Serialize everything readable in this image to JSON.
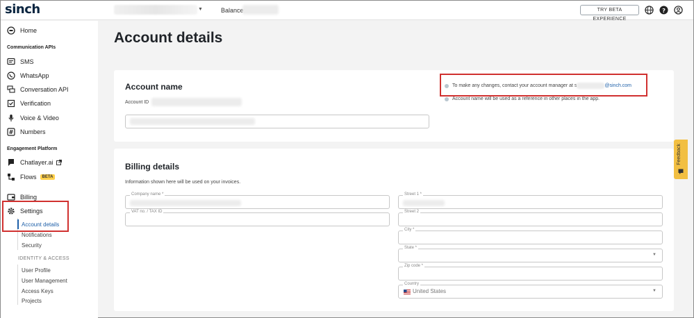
{
  "header": {
    "logo": "sinch",
    "balance_label": "Balance:",
    "beta_button": "TRY BETA EXPERIENCE",
    "icons": [
      "globe-icon",
      "help-icon",
      "user-icon"
    ]
  },
  "sidebar": {
    "home": "Home",
    "section_comm": "Communication APIs",
    "comm_items": [
      "SMS",
      "WhatsApp",
      "Conversation API",
      "Verification",
      "Voice & Video",
      "Numbers"
    ],
    "section_engagement": "Engagement Platform",
    "chatlayer": "Chatlayer.ai",
    "flows": "Flows",
    "beta_tag": "BETA",
    "billing": "Billing",
    "settings": "Settings",
    "settings_sub": [
      "Account details",
      "Notifications",
      "Security"
    ],
    "identity_group": "IDENTITY & ACCESS",
    "identity_sub": [
      "User Profile",
      "User Management",
      "Access Keys",
      "Projects"
    ]
  },
  "main": {
    "page_title": "Account details",
    "account_name": {
      "title": "Account name",
      "account_id_label": "Account ID",
      "info_contact_prefix": "To make any changes, contact your account manager at s",
      "info_contact_email_suffix": "@sinch.com",
      "info_reference": "Account name will be used as a reference in other places in the app."
    },
    "billing": {
      "title": "Billing details",
      "subtitle": "Information shown here will be used on your invoices.",
      "company_name": "Company name *",
      "vat": "VAT no. / TAX ID",
      "street1": "Street 1 *",
      "street2": "Street 2",
      "city": "City *",
      "state": "State *",
      "zip": "Zip code *",
      "country_label": "Country",
      "country_value": "United States"
    },
    "feedback": "Feedback"
  },
  "colors": {
    "highlight": "#d0302f",
    "beta_tag": "#ffd04b",
    "feedback_tab": "#f2bf42",
    "link": "#1d5fa8"
  }
}
